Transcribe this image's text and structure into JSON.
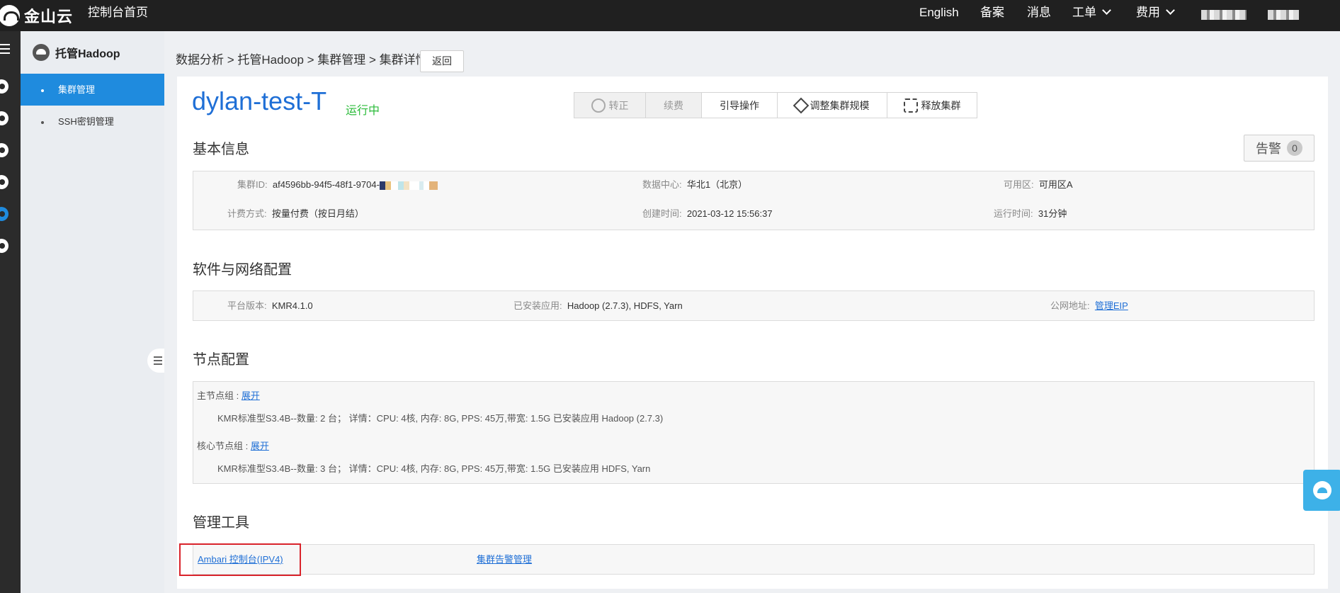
{
  "topbar": {
    "logo_text": "金山云",
    "console_home": "控制台首页",
    "nav": {
      "english": "English",
      "beian": "备案",
      "messages": "消息",
      "ticket": "工单",
      "billing": "费用"
    }
  },
  "sidebar": {
    "title": "托管Hadoop",
    "items": [
      {
        "label": "集群管理",
        "active": true
      },
      {
        "label": "SSH密钥管理",
        "active": false
      }
    ]
  },
  "breadcrumb": "数据分析 > 托管Hadoop > 集群管理 > 集群详情",
  "back_label": "返回",
  "cluster": {
    "name": "dylan-test-T",
    "status": "运行中"
  },
  "actions": [
    {
      "label": "转正",
      "disabled": true,
      "icon": "database-icon"
    },
    {
      "label": "续费",
      "disabled": true,
      "icon": ""
    },
    {
      "label": "引导操作",
      "disabled": false,
      "icon": ""
    },
    {
      "label": "调整集群规模",
      "disabled": false,
      "icon": "wrench-icon"
    },
    {
      "label": "释放集群",
      "disabled": false,
      "icon": "release-icon"
    }
  ],
  "alert": {
    "label": "告警",
    "count": "0"
  },
  "basic_info": {
    "title": "基本信息",
    "cluster_id_key": "集群ID:",
    "cluster_id_value": "af4596bb-94f5-48f1-9704-",
    "datacenter_key": "数据中心:",
    "datacenter_value": "华北1（北京）",
    "zone_key": "可用区:",
    "zone_value": "可用区A",
    "billing_key": "计费方式:",
    "billing_value": "按量付费（按日月结）",
    "created_key": "创建时间:",
    "created_value": "2021-03-12 15:56:37",
    "uptime_key": "运行时间:",
    "uptime_value": "31分钟"
  },
  "software": {
    "title": "软件与网络配置",
    "platform_key": "平台版本:",
    "platform_value": "KMR4.1.0",
    "apps_key": "已安装应用:",
    "apps_value": "Hadoop (2.7.3), HDFS, Yarn",
    "public_key": "公网地址:",
    "public_link": "管理EIP"
  },
  "nodes": {
    "title": "节点配置",
    "master_label": "主节点组 :",
    "master_expand": "展开",
    "master_detail": "KMR标准型S3.4B--数量: 2 台；  详情：CPU: 4核, 内存: 8G, PPS: 45万,带宽: 1.5G 已安装应用 Hadoop (2.7.3)",
    "core_label": "核心节点组 :",
    "core_expand": "展开",
    "core_detail": "KMR标准型S3.4B--数量: 3 台；  详情：CPU: 4核, 内存: 8G, PPS: 45万,带宽: 1.5G 已安装应用 HDFS, Yarn"
  },
  "tools": {
    "title": "管理工具",
    "ambari_link": "Ambari 控制台(IPV4)",
    "alert_mgmt_link": "集群告警管理"
  },
  "colors": {
    "accent": "#1f8bde",
    "link": "#1f6fd6",
    "status_running": "#2bbb3a",
    "highlight": "#d9232b",
    "topbar": "#202020"
  }
}
